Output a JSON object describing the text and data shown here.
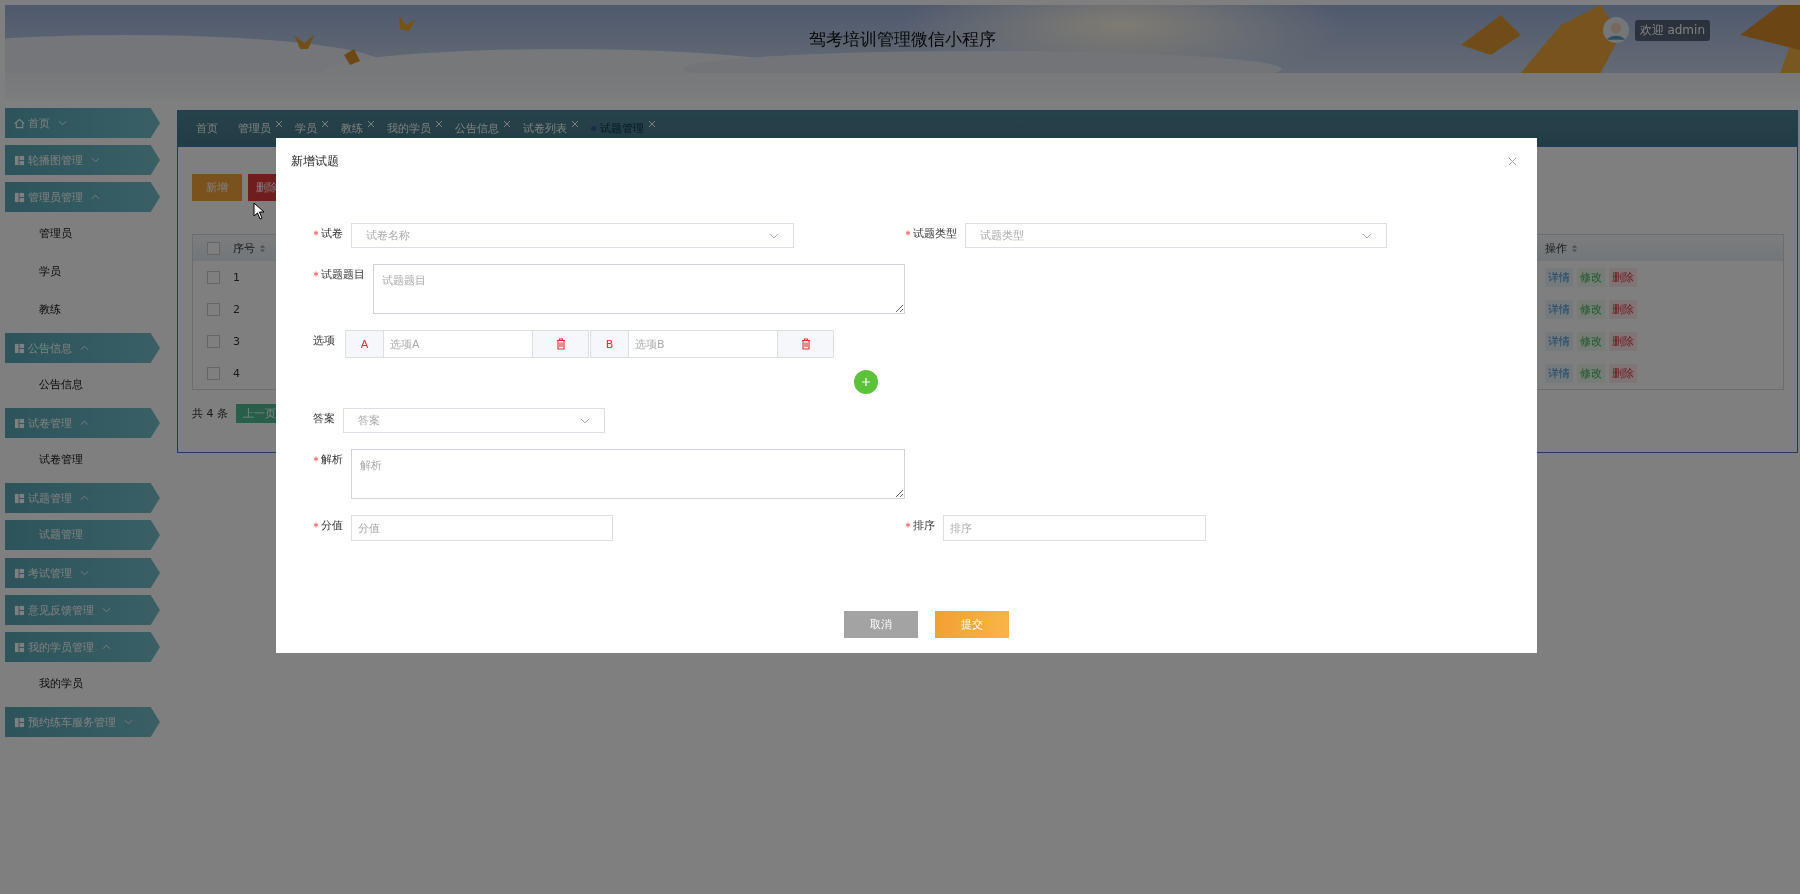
{
  "header": {
    "title": "驾考培训管理微信小程序",
    "welcome": "欢迎 admin"
  },
  "sidebar": {
    "items": [
      {
        "label": "首页",
        "expanded": false
      },
      {
        "label": "轮播图管理",
        "expanded": false
      },
      {
        "label": "管理员管理",
        "expanded": true,
        "children": [
          {
            "label": "管理员",
            "selected": false
          },
          {
            "label": "学员",
            "selected": false
          },
          {
            "label": "教练",
            "selected": false
          }
        ]
      },
      {
        "label": "公告信息",
        "expanded": true,
        "children": [
          {
            "label": "公告信息",
            "selected": false
          }
        ]
      },
      {
        "label": "试卷管理",
        "expanded": true,
        "children": [
          {
            "label": "试卷管理",
            "selected": false
          }
        ]
      },
      {
        "label": "试题管理",
        "expanded": true,
        "children": [
          {
            "label": "试题管理",
            "selected": true
          }
        ]
      },
      {
        "label": "考试管理",
        "expanded": false
      },
      {
        "label": "意见反馈管理",
        "expanded": false
      },
      {
        "label": "我的学员管理",
        "expanded": true,
        "children": [
          {
            "label": "我的学员",
            "selected": false
          }
        ]
      },
      {
        "label": "预约练车服务管理",
        "expanded": false
      }
    ]
  },
  "tabs": [
    {
      "label": "首页",
      "closable": false,
      "selected": false
    },
    {
      "label": "管理员",
      "closable": true,
      "selected": false
    },
    {
      "label": "学员",
      "closable": true,
      "selected": false
    },
    {
      "label": "教练",
      "closable": true,
      "selected": false
    },
    {
      "label": "我的学员",
      "closable": true,
      "selected": false
    },
    {
      "label": "公告信息",
      "closable": true,
      "selected": false
    },
    {
      "label": "试卷列表",
      "closable": true,
      "selected": false
    },
    {
      "label": "试题管理",
      "closable": true,
      "selected": true
    }
  ],
  "toolbar": [
    {
      "label": "新增",
      "kind": "add"
    },
    {
      "label": "删除",
      "kind": "delete"
    }
  ],
  "table": {
    "all_checked": false,
    "number_header": "序号",
    "actions_header": "操作",
    "rows": [
      {
        "number": "1",
        "checked": false,
        "actions": [
          {
            "label": "详情",
            "kind": "view"
          },
          {
            "label": "修改",
            "kind": "edit"
          },
          {
            "label": "删除",
            "kind": "delete"
          }
        ]
      },
      {
        "number": "2",
        "checked": false,
        "actions": [
          {
            "label": "详情",
            "kind": "view"
          },
          {
            "label": "修改",
            "kind": "edit"
          },
          {
            "label": "删除",
            "kind": "delete"
          }
        ]
      },
      {
        "number": "3",
        "checked": false,
        "actions": [
          {
            "label": "详情",
            "kind": "view"
          },
          {
            "label": "修改",
            "kind": "edit"
          },
          {
            "label": "删除",
            "kind": "delete"
          }
        ]
      },
      {
        "number": "4",
        "checked": false,
        "actions": [
          {
            "label": "详情",
            "kind": "view"
          },
          {
            "label": "修改",
            "kind": "edit"
          },
          {
            "label": "删除",
            "kind": "delete"
          }
        ]
      }
    ]
  },
  "pagination": {
    "total": "共 4 条",
    "prev": "上一页"
  },
  "modal": {
    "title": "新增试题",
    "rows": [
      [
        {
          "kind": "select",
          "label": "试卷",
          "required": true,
          "placeholder": "试卷名称"
        },
        {
          "kind": "select",
          "label": "试题类型",
          "required": true,
          "placeholder": "试题类型"
        }
      ],
      [
        {
          "kind": "textarea",
          "label": "试题题目",
          "required": true,
          "placeholder": "试题题目"
        }
      ],
      [
        {
          "kind": "options",
          "label": "选项",
          "required": false,
          "options": [
            {
              "letter": "A",
              "placeholder": "选项A"
            },
            {
              "letter": "B",
              "placeholder": "选项B"
            }
          ]
        }
      ],
      [
        {
          "kind": "select",
          "label": "答案",
          "required": false,
          "placeholder": "答案"
        }
      ],
      [
        {
          "kind": "textarea",
          "label": "解析",
          "required": true,
          "placeholder": "解析"
        }
      ],
      [
        {
          "kind": "input",
          "label": "分值",
          "required": true,
          "placeholder": "分值"
        },
        {
          "kind": "input",
          "label": "排序",
          "required": true,
          "placeholder": "排序"
        }
      ]
    ],
    "buttons": [
      {
        "label": "取消",
        "kind": "cancel"
      },
      {
        "label": "提交",
        "kind": "submit"
      }
    ]
  }
}
